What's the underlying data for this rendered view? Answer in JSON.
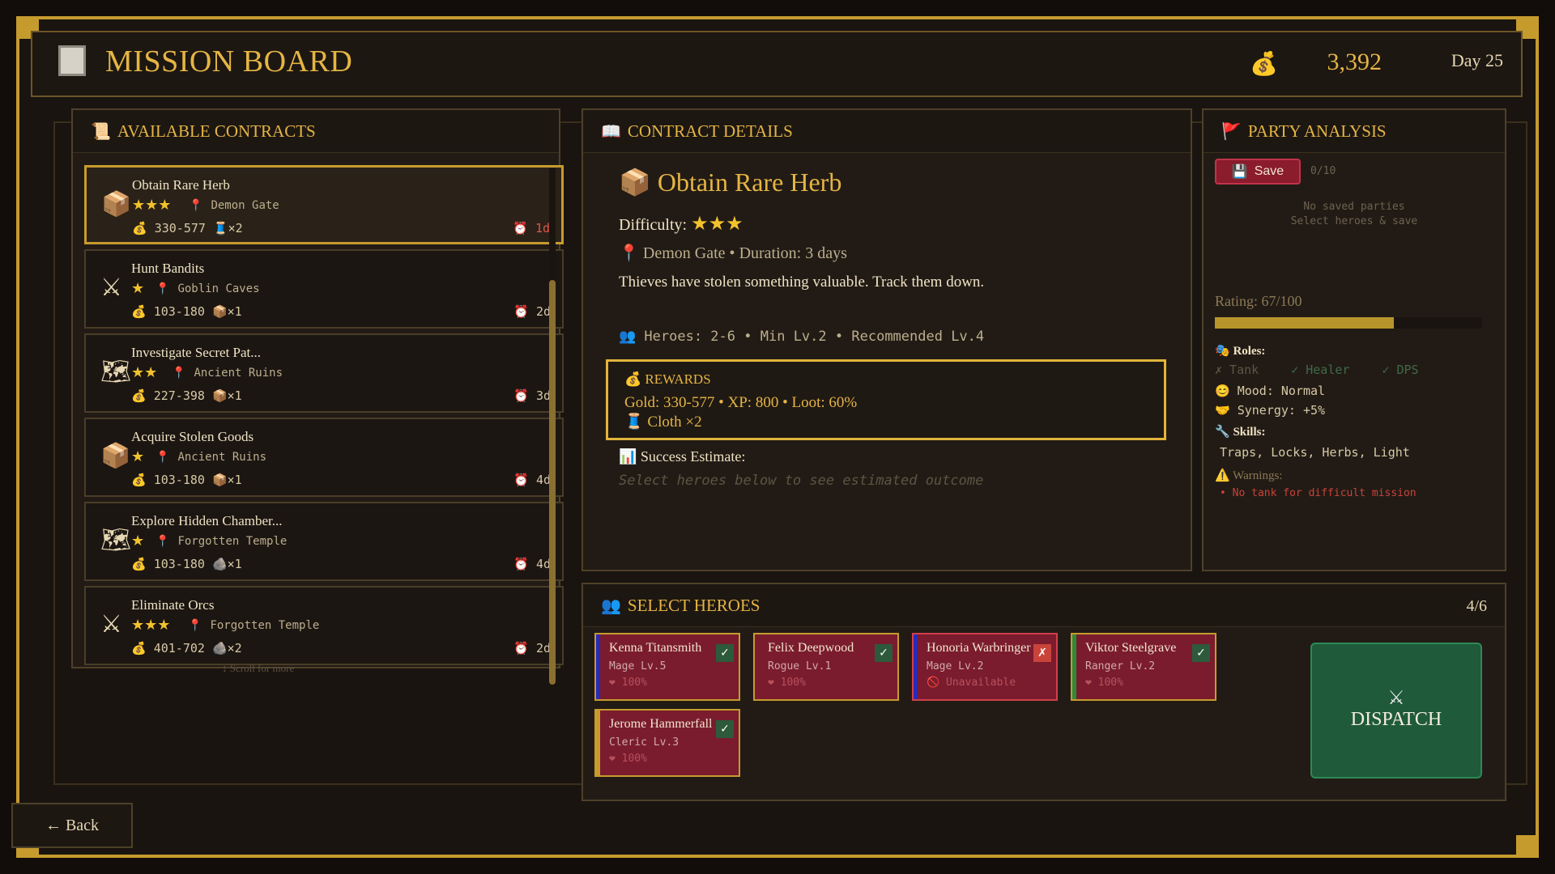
{
  "header": {
    "title": "MISSION BOARD",
    "gold": "3,392",
    "day": "Day 25"
  },
  "contracts_panel": {
    "title": "AVAILABLE CONTRACTS",
    "scroll_hint": "↕ Scroll for more",
    "items": [
      {
        "name": "Obtain Rare Herb",
        "icon": "crate-icon",
        "stars": "★★★",
        "location": "Demon Gate",
        "reward": "330-577",
        "loot": "×2",
        "loot_icon": "cloth-icon",
        "time": "1d",
        "urgent": true,
        "selected": true
      },
      {
        "name": "Hunt Bandits",
        "icon": "swords-icon",
        "stars": "★",
        "location": "Goblin Caves",
        "reward": "103-180",
        "loot": "×1",
        "loot_icon": "crate-icon",
        "time": "2d",
        "urgent": false
      },
      {
        "name": "Investigate Secret Pat...",
        "icon": "map-icon",
        "stars": "★★",
        "location": "Ancient Ruins",
        "reward": "227-398",
        "loot": "×1",
        "loot_icon": "crate-icon",
        "time": "3d",
        "urgent": false
      },
      {
        "name": "Acquire Stolen Goods",
        "icon": "crate-icon",
        "stars": "★",
        "location": "Ancient Ruins",
        "reward": "103-180",
        "loot": "×1",
        "loot_icon": "crate-icon",
        "time": "4d",
        "urgent": false
      },
      {
        "name": "Explore Hidden Chamber...",
        "icon": "map-icon",
        "stars": "★",
        "location": "Forgotten Temple",
        "reward": "103-180",
        "loot": "×1",
        "loot_icon": "ore-icon",
        "time": "4d",
        "urgent": false
      },
      {
        "name": "Eliminate Orcs",
        "icon": "swords-icon",
        "stars": "★★★",
        "location": "Forgotten Temple",
        "reward": "401-702",
        "loot": "×2",
        "loot_icon": "ore-icon",
        "time": "2d",
        "urgent": false
      }
    ]
  },
  "details": {
    "panel_title": "CONTRACT DETAILS",
    "name": "Obtain Rare Herb",
    "difficulty_label": "Difficulty:",
    "difficulty_stars": "★★★",
    "location": "Demon Gate",
    "duration": "Duration: 3 days",
    "description": "Thieves have stolen something valuable. Track them down.",
    "heroes": "Heroes: 2-6",
    "min_level": "Min Lv.2",
    "recommended": "Recommended Lv.4",
    "rewards_title": "REWARDS",
    "gold": "Gold: 330-577",
    "xp": "XP: 800",
    "loot": "Loot: 60%",
    "items": "Cloth ×2",
    "success_title": "Success Estimate:",
    "success_hint": "Select heroes below to see estimated outcome"
  },
  "party": {
    "panel_title": "PARTY ANALYSIS",
    "save_label": "Save",
    "save_count": "0/10",
    "empty_line1": "No saved parties",
    "empty_line2": "Select heroes & save",
    "rating": "Rating: 67/100",
    "rating_value": 67,
    "roles_label": "Roles:",
    "roles": [
      {
        "label": "✗ Tank",
        "present": false
      },
      {
        "label": "✓ Healer",
        "present": true
      },
      {
        "label": "✓ DPS",
        "present": true
      }
    ],
    "mood": "Mood: Normal",
    "synergy": "Synergy: +5%",
    "skills_label": "Skills:",
    "skills": "Traps, Locks, Herbs, Light",
    "warnings_label": "Warnings:",
    "warning": "• No tank for difficult mission"
  },
  "heroes_panel": {
    "title": "SELECT HEROES",
    "count": "4/6",
    "dispatch_label": "DISPATCH",
    "heroes": [
      {
        "name": "Kenna Titansmith",
        "class": "Mage Lv.5",
        "status": "100%",
        "selected": true,
        "available": true,
        "stripe": "#2a2ab8"
      },
      {
        "name": "Felix Deepwood",
        "class": "Rogue Lv.1",
        "status": "100%",
        "selected": true,
        "available": true,
        "stripe": "#7a1c2e"
      },
      {
        "name": "Honoria Warbringer",
        "class": "Mage Lv.2",
        "status": "Unavailable",
        "selected": false,
        "available": false,
        "stripe": "#2a2ab8"
      },
      {
        "name": "Viktor Steelgrave",
        "class": "Ranger Lv.2",
        "status": "100%",
        "selected": true,
        "available": true,
        "stripe": "#2f8a3a"
      },
      {
        "name": "Jerome Hammerfall",
        "class": "Cleric Lv.3",
        "status": "100%",
        "selected": true,
        "available": true,
        "stripe": "#c69b2e"
      }
    ]
  },
  "footer": {
    "back_label": "← Back"
  },
  "colors": {
    "accent": "#e5b544",
    "danger": "#c9433b",
    "hero_card": "#7a1c2e",
    "dispatch": "#1f5a3a"
  }
}
